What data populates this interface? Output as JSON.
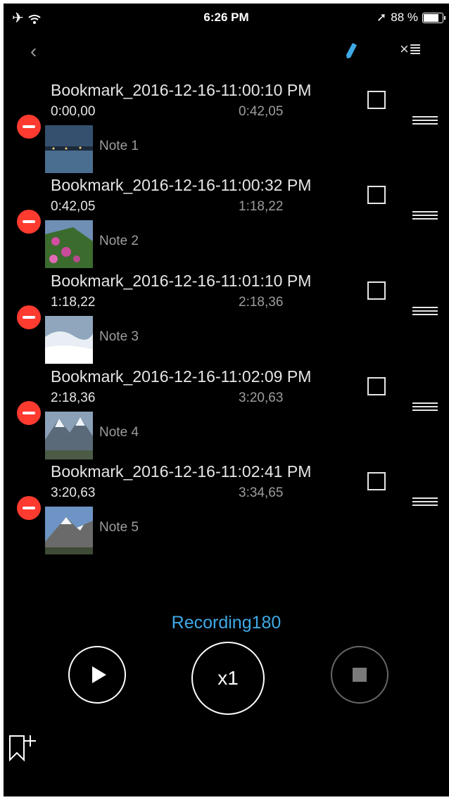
{
  "status_bar": {
    "time": "6:26 PM",
    "battery": "88 %",
    "battery_level": 0.88
  },
  "bookmarks": [
    {
      "title": "Bookmark_2016-12-16-11:00:10 PM",
      "start": "0:00,00",
      "end": "0:42,05",
      "note": "Note 1",
      "thumb": "harbor-night"
    },
    {
      "title": "Bookmark_2016-12-16-11:00:32 PM",
      "start": "0:42,05",
      "end": "1:18,22",
      "note": "Note 2",
      "thumb": "flowers-cliff"
    },
    {
      "title": "Bookmark_2016-12-16-11:01:10 PM",
      "start": "1:18,22",
      "end": "2:18,36",
      "note": "Note 3",
      "thumb": "snowy-landscape"
    },
    {
      "title": "Bookmark_2016-12-16-11:02:09 PM",
      "start": "2:18,36",
      "end": "3:20,63",
      "note": "Note 4",
      "thumb": "mountain-valley"
    },
    {
      "title": "Bookmark_2016-12-16-11:02:41 PM",
      "start": "3:20,63",
      "end": "3:34,65",
      "note": "Note 5",
      "thumb": "snow-peak"
    }
  ],
  "player": {
    "recording_name": "Recording180",
    "speed_label": "x1"
  },
  "colors": {
    "accent": "#3fa9e6",
    "delete": "#ff3b30",
    "background": "#000000"
  }
}
